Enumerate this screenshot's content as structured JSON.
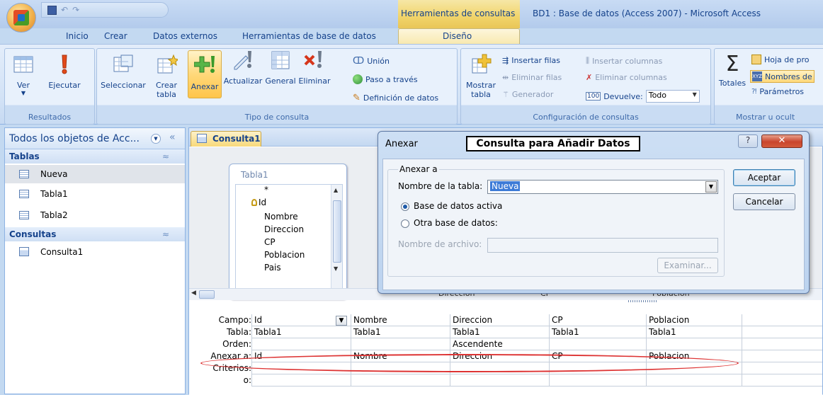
{
  "window": {
    "context_label": "Herramientas de consultas",
    "title": "BD1 : Base de datos (Access 2007) - Microsoft Access"
  },
  "tabs": [
    {
      "label": "Inicio"
    },
    {
      "label": "Crear"
    },
    {
      "label": "Datos externos"
    },
    {
      "label": "Herramientas de base de datos"
    },
    {
      "label": "Diseño",
      "active": true
    }
  ],
  "ribbon": {
    "resultados": {
      "label": "Resultados",
      "ver": "Ver",
      "ejecutar": "Ejecutar"
    },
    "tipo": {
      "label": "Tipo de consulta",
      "seleccionar": "Seleccionar",
      "crear_tabla_1": "Crear",
      "crear_tabla_2": "tabla",
      "anexar": "Anexar",
      "actualizar": "Actualizar",
      "general": "General",
      "eliminar": "Eliminar",
      "union": "Unión",
      "paso": "Paso a través",
      "definicion": "Definición de datos"
    },
    "config": {
      "label": "Configuración de consultas",
      "mostrar_1": "Mostrar",
      "mostrar_2": "tabla",
      "insertar_filas": "Insertar filas",
      "eliminar_filas": "Eliminar filas",
      "generador": "Generador",
      "insertar_columnas": "Insertar columnas",
      "eliminar_columnas": "Eliminar columnas",
      "devuelve": "Devuelve:",
      "devuelve_value": "Todo"
    },
    "mostrar": {
      "label": "Mostrar u ocult",
      "totales": "Totales",
      "hoja": "Hoja de pro",
      "nombres": "Nombres de",
      "parametros": "Parámetros"
    }
  },
  "nav": {
    "title": "Todos los objetos de Acc...",
    "sections": [
      {
        "label": "Tablas",
        "items": [
          "Nueva",
          "Tabla1",
          "Tabla2"
        ]
      },
      {
        "label": "Consultas",
        "items": [
          "Consulta1"
        ]
      }
    ]
  },
  "doc": {
    "tab": "Consulta1",
    "table_title": "Tabla1",
    "fields": [
      "*",
      "Id",
      "Nombre",
      "Direccion",
      "CP",
      "Poblacion",
      "Pais"
    ]
  },
  "grid": {
    "row_labels": [
      "Campo:",
      "Tabla:",
      "Orden:",
      "Anexar a:",
      "Criterios:",
      "o:"
    ],
    "columns": [
      {
        "campo": "Id",
        "tabla": "Tabla1",
        "orden": "",
        "anexar": "Id"
      },
      {
        "campo": "Nombre",
        "tabla": "Tabla1",
        "orden": "",
        "anexar": "Nombre"
      },
      {
        "campo": "Direccion",
        "tabla": "Tabla1",
        "orden": "Ascendente",
        "anexar": "Direccion"
      },
      {
        "campo": "CP",
        "tabla": "Tabla1",
        "orden": "",
        "anexar": "CP"
      },
      {
        "campo": "Poblacion",
        "tabla": "Tabla1",
        "orden": "",
        "anexar": "Poblacion"
      }
    ],
    "hidden_headers": [
      "Direccion",
      "CP",
      "Poblacion"
    ]
  },
  "dialog": {
    "title": "Anexar",
    "caption": "Consulta para Añadir Datos",
    "group": "Anexar a",
    "table_label": "Nombre de la tabla:",
    "table_value": "Nueva",
    "radio_active": "Base de datos activa",
    "radio_other": "Otra base de datos:",
    "file_label": "Nombre de archivo:",
    "browse": "Examinar...",
    "ok": "Aceptar",
    "cancel": "Cancelar"
  }
}
